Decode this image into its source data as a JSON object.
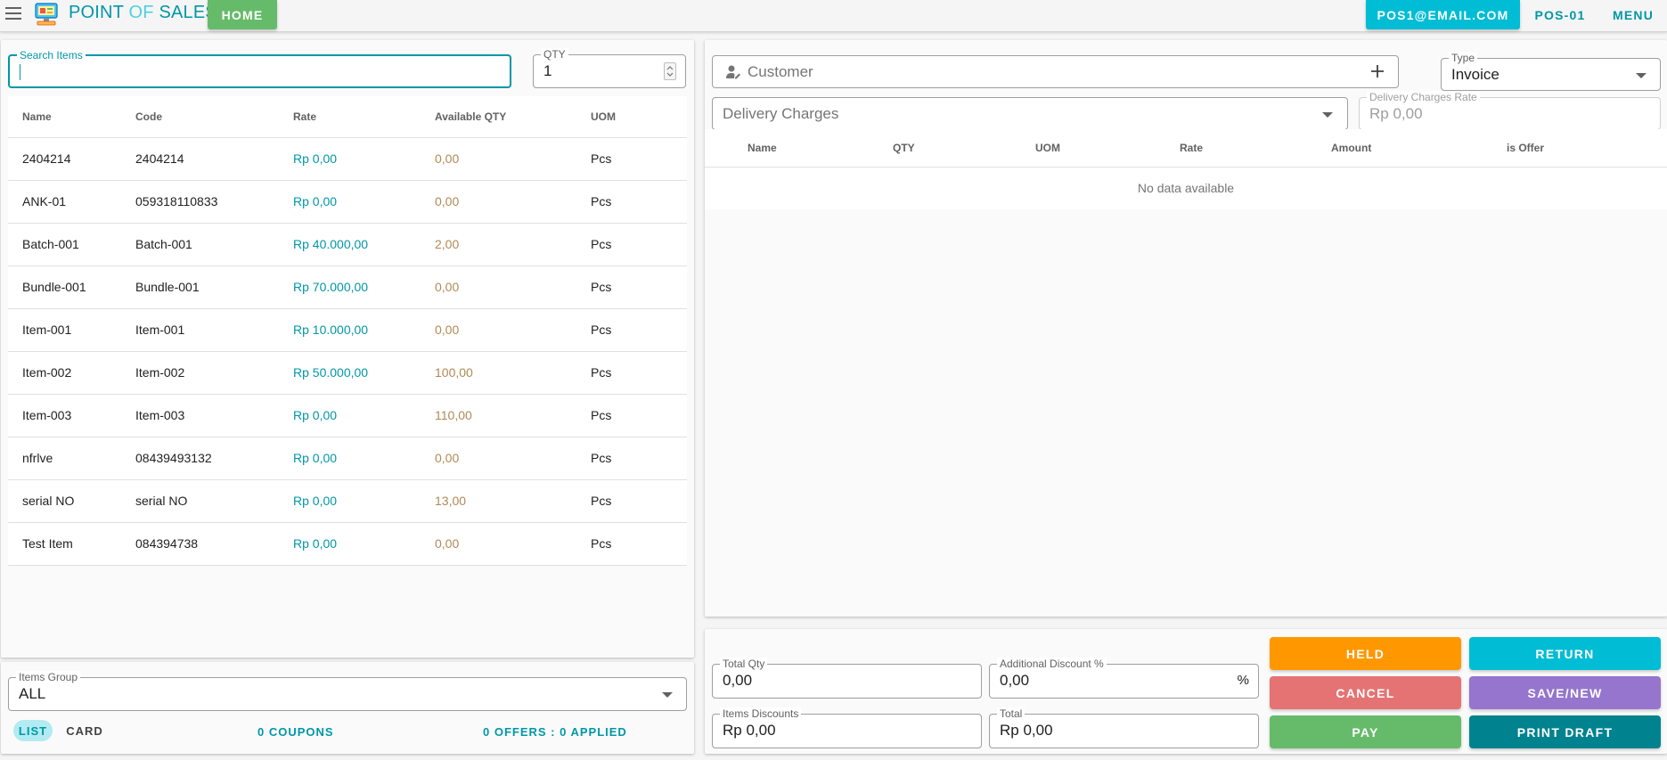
{
  "topbar": {
    "title_main": "POINT ",
    "title_of": "OF",
    "title_end": " SALES",
    "home_label": "HOME",
    "user_email": "POS1@EMAIL.COM",
    "pos_profile": "POS-01",
    "menu_label": "MENU"
  },
  "search": {
    "label": "Search Items",
    "value": ""
  },
  "qty": {
    "label": "QTY",
    "value": "1"
  },
  "items_table": {
    "headers": [
      "Name",
      "Code",
      "Rate",
      "Available QTY",
      "UOM"
    ],
    "rows": [
      {
        "name": "2404214",
        "code": "2404214",
        "rate": "Rp 0,00",
        "qty": "0,00",
        "uom": "Pcs"
      },
      {
        "name": "ANK-01",
        "code": "059318110833",
        "rate": "Rp 0,00",
        "qty": "0,00",
        "uom": "Pcs"
      },
      {
        "name": "Batch-001",
        "code": "Batch-001",
        "rate": "Rp 40.000,00",
        "qty": "2,00",
        "uom": "Pcs"
      },
      {
        "name": "Bundle-001",
        "code": "Bundle-001",
        "rate": "Rp 70.000,00",
        "qty": "0,00",
        "uom": "Pcs"
      },
      {
        "name": "Item-001",
        "code": "Item-001",
        "rate": "Rp 10.000,00",
        "qty": "0,00",
        "uom": "Pcs"
      },
      {
        "name": "Item-002",
        "code": "Item-002",
        "rate": "Rp 50.000,00",
        "qty": "100,00",
        "uom": "Pcs"
      },
      {
        "name": "Item-003",
        "code": "Item-003",
        "rate": "Rp 0,00",
        "qty": "110,00",
        "uom": "Pcs"
      },
      {
        "name": "nfrlve",
        "code": "08439493132",
        "rate": "Rp 0,00",
        "qty": "0,00",
        "uom": "Pcs"
      },
      {
        "name": "serial NO",
        "code": "serial NO",
        "rate": "Rp 0,00",
        "qty": "13,00",
        "uom": "Pcs"
      },
      {
        "name": "Test Item",
        "code": "084394738",
        "rate": "Rp 0,00",
        "qty": "0,00",
        "uom": "Pcs"
      }
    ]
  },
  "items_group": {
    "label": "Items Group",
    "value": "ALL"
  },
  "view_tabs": {
    "list": "LIST",
    "card": "CARD"
  },
  "coupons_text": "0 COUPONS",
  "offers_text": "0 OFFERS : 0 APPLIED",
  "customer": {
    "placeholder": "Customer"
  },
  "type": {
    "label": "Type",
    "value": "Invoice"
  },
  "delivery": {
    "placeholder": "Delivery Charges",
    "rate_label": "Delivery Charges Rate",
    "rate_value": "Rp 0,00"
  },
  "cart_table": {
    "headers": [
      "Name",
      "QTY",
      "UOM",
      "Rate",
      "Amount",
      "is Offer"
    ],
    "empty_text": "No data available"
  },
  "totals": {
    "total_qty_label": "Total Qty",
    "total_qty_value": "0,00",
    "additional_discount_label": "Additional Discount %",
    "additional_discount_value": "0,00",
    "percent_suffix": "%",
    "items_discounts_label": "Items Discounts",
    "items_discounts_value": "Rp 0,00",
    "total_label": "Total",
    "total_value": "Rp 0,00"
  },
  "actions": {
    "held": "HELD",
    "return": "RETURN",
    "cancel": "CANCEL",
    "save_new": "SAVE/NEW",
    "pay": "PAY",
    "print_draft": "PRINT DRAFT"
  },
  "colors": {
    "primary": "#0097a7",
    "home": "#66bb6a",
    "email": "#00bcd4",
    "held": "#ff9800",
    "return": "#00bcd4",
    "cancel": "#e57373",
    "save_new": "#9575cd",
    "pay": "#66bb6a",
    "print_draft": "#00838f"
  }
}
